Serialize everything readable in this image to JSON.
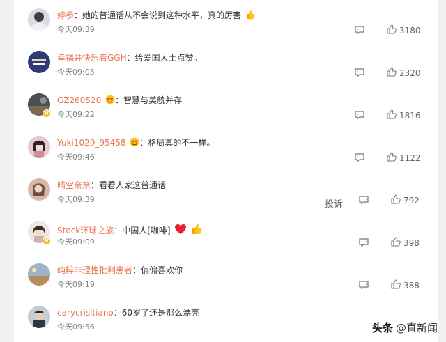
{
  "comments": [
    {
      "user": "婷参",
      "badge": false,
      "text": "她的普通话从不会说到这种水平，真的厉害",
      "emoji": "thumbs-up-emoji",
      "time": "今天09:39",
      "likes": "3180"
    },
    {
      "user": "幸福并快乐着GGH",
      "badge": false,
      "text": "给爱国人士点赞。",
      "emoji": "",
      "time": "今天09:05",
      "likes": "2320"
    },
    {
      "user": "GZ260520",
      "badge": true,
      "text": "智慧与美貌并存",
      "emoji": "heart-eyes-emoji",
      "time": "今天09:22",
      "likes": "1816"
    },
    {
      "user": "Yuki1029_95458",
      "badge": false,
      "text": "格局真的不一样。",
      "emoji": "heart-eyes-emoji",
      "time": "今天09:46",
      "likes": "1122"
    },
    {
      "user": "晴空奈奈",
      "badge": false,
      "text": "看看人家这普通话",
      "emoji": "",
      "time": "今天09:39",
      "likes": "792"
    },
    {
      "user": "Stock环球之旅",
      "badge": true,
      "text": "中国人[咖啡]",
      "emoji": "heart-thumbs-emoji",
      "time": "今天09:09",
      "likes": "398"
    },
    {
      "user": "纯粹非理性批判患者",
      "badge": false,
      "text": "偏偏喜欢你",
      "emoji": "",
      "time": "今天09:19",
      "likes": "388"
    },
    {
      "user": "carycrisitiano",
      "badge": false,
      "text": "60岁了还是那么漂亮",
      "emoji": "",
      "time": "今天09:56",
      "likes": ""
    }
  ],
  "complain_label": "投诉",
  "colon": "：",
  "watermark": {
    "logo": "头条",
    "text": "@直新闻"
  },
  "colors": {
    "username": "#eb7350",
    "text": "#333333",
    "time": "#808080",
    "background": "#f1f1f1"
  }
}
